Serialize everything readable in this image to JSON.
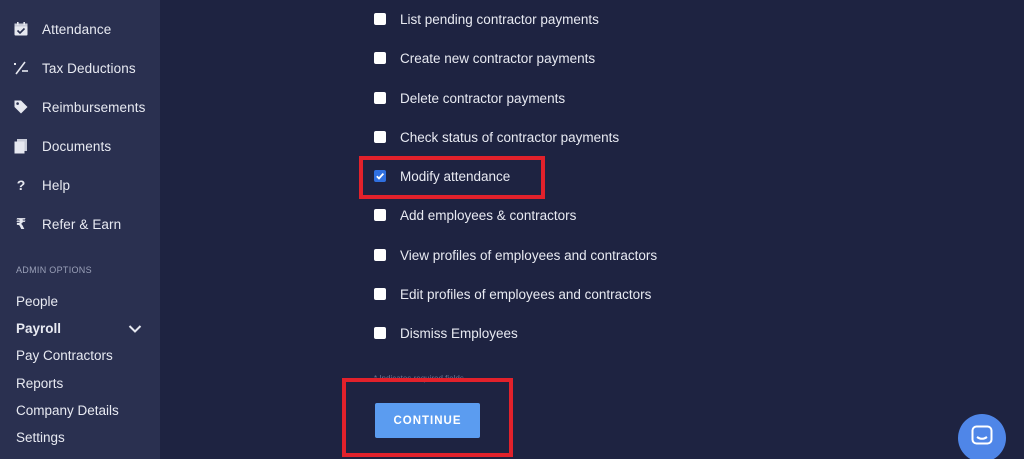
{
  "sidebar": {
    "nav_items": [
      {
        "label": "Attendance",
        "icon": "calendar-check-icon"
      },
      {
        "label": "Tax Deductions",
        "icon": "percent-icon"
      },
      {
        "label": "Reimbursements",
        "icon": "tag-icon"
      },
      {
        "label": "Documents",
        "icon": "documents-icon"
      },
      {
        "label": "Help",
        "icon": "help-icon"
      },
      {
        "label": "Refer & Earn",
        "icon": "rupee-icon"
      }
    ],
    "admin_heading": "ADMIN OPTIONS",
    "admin_items": [
      {
        "label": "People"
      },
      {
        "label": "Payroll",
        "expanded": true
      },
      {
        "label": "Pay Contractors"
      },
      {
        "label": "Reports"
      },
      {
        "label": "Company Details"
      },
      {
        "label": "Settings"
      }
    ]
  },
  "permissions": [
    {
      "label": "List pending contractor payments",
      "checked": false
    },
    {
      "label": "Create new contractor payments",
      "checked": false
    },
    {
      "label": "Delete contractor payments",
      "checked": false
    },
    {
      "label": "Check status of contractor payments",
      "checked": false
    },
    {
      "label": "Modify attendance",
      "checked": true
    },
    {
      "label": "Add employees & contractors",
      "checked": false
    },
    {
      "label": "View profiles of employees and contractors",
      "checked": false
    },
    {
      "label": "Edit profiles of employees and contractors",
      "checked": false
    },
    {
      "label": "Dismiss Employees",
      "checked": false
    }
  ],
  "form": {
    "required_note": "* Indicates required fields",
    "continue_label": "CONTINUE"
  },
  "chat": {
    "icon": "chat-icon"
  },
  "colors": {
    "background": "#1e2341",
    "sidebar": "#2a3050",
    "accent": "#5b9cf0",
    "highlight": "#e2212b"
  }
}
